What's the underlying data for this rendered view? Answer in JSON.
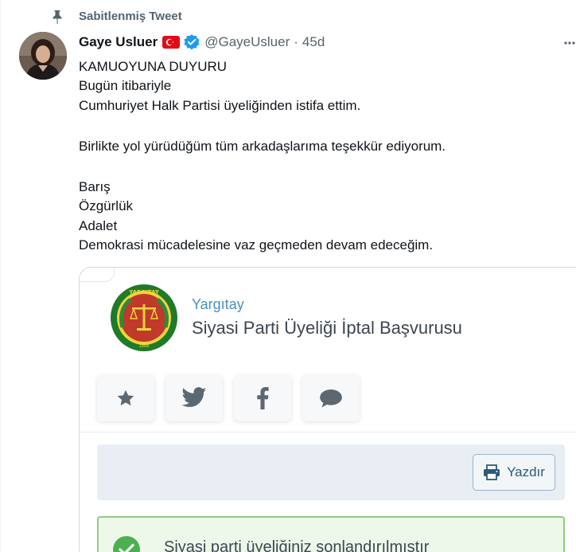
{
  "pinned": {
    "label": "Sabitlenmiş Tweet",
    "icon": "pin-icon"
  },
  "author": {
    "display_name": "Gaye Usluer",
    "flag_icon": "turkey-flag-icon",
    "verified_icon": "verified-badge-icon",
    "handle": "@GayeUsluer",
    "separator": "·",
    "time": "45d"
  },
  "more_icon": "more-options-icon",
  "tweet": {
    "lines": [
      "KAMUOYUNA DUYURU",
      "Bugün itibariyle",
      "Cumhuriyet Halk Partisi üyeliğinden istifa ettim.",
      "Birlikte yol yürüdüğüm tüm arkadaşlarıma teşekkür ediyorum.",
      "Barış",
      "Özgürlük",
      "Adalet",
      "Demokrasi mücadelesine vaz geçmeden devam edeceğim."
    ]
  },
  "card": {
    "seal_icon": "yargitay-seal-icon",
    "site_name": "Yargıtay",
    "title": "Siyasi Parti Üyeliği İptal Başvurusu",
    "share_buttons": [
      {
        "name": "favorite-star-icon"
      },
      {
        "name": "twitter-bird-icon"
      },
      {
        "name": "facebook-icon"
      },
      {
        "name": "comment-bubble-icon"
      }
    ],
    "print_label": "Yazdır",
    "print_icon": "printer-icon",
    "success_text": "Siyasi parti üyeliğiniz sonlandırılmıştır",
    "success_icon": "check-circle-icon"
  },
  "colors": {
    "text_primary": "#0f1419",
    "text_secondary": "#536471",
    "verified_blue": "#1d9bf0",
    "flag_red": "#e30a17",
    "link_blue": "#4a8fbf",
    "success_green": "#4caf50",
    "panel_blue": "#e9eef5"
  }
}
